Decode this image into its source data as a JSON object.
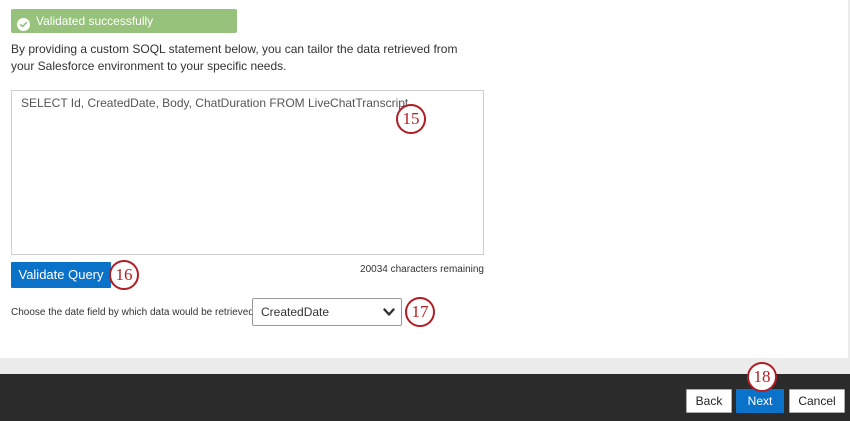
{
  "banner": {
    "text": "Validated successfully",
    "icon": "check-circle-icon",
    "color": "#97c27b"
  },
  "description": "By providing a custom SOQL statement below, you can tailor the data retrieved from your Salesforce environment to your specific needs.",
  "query": {
    "value": "SELECT Id, CreatedDate, Body, ChatDuration FROM LiveChatTranscript",
    "chars_remaining": "20034 characters remaining"
  },
  "validate_button": "Validate Query",
  "date_field": {
    "label": "Choose the date field by which data would be retrieved",
    "selected": "CreatedDate",
    "icon": "chevron-down-icon"
  },
  "steps": [
    "15",
    "16",
    "17",
    "18"
  ],
  "footer": {
    "back": "Back",
    "next": "Next",
    "cancel": "Cancel"
  },
  "colors": {
    "primary": "#0b72c9",
    "step_marker": "#b01e24",
    "footer_bg": "#2b2b2b"
  }
}
